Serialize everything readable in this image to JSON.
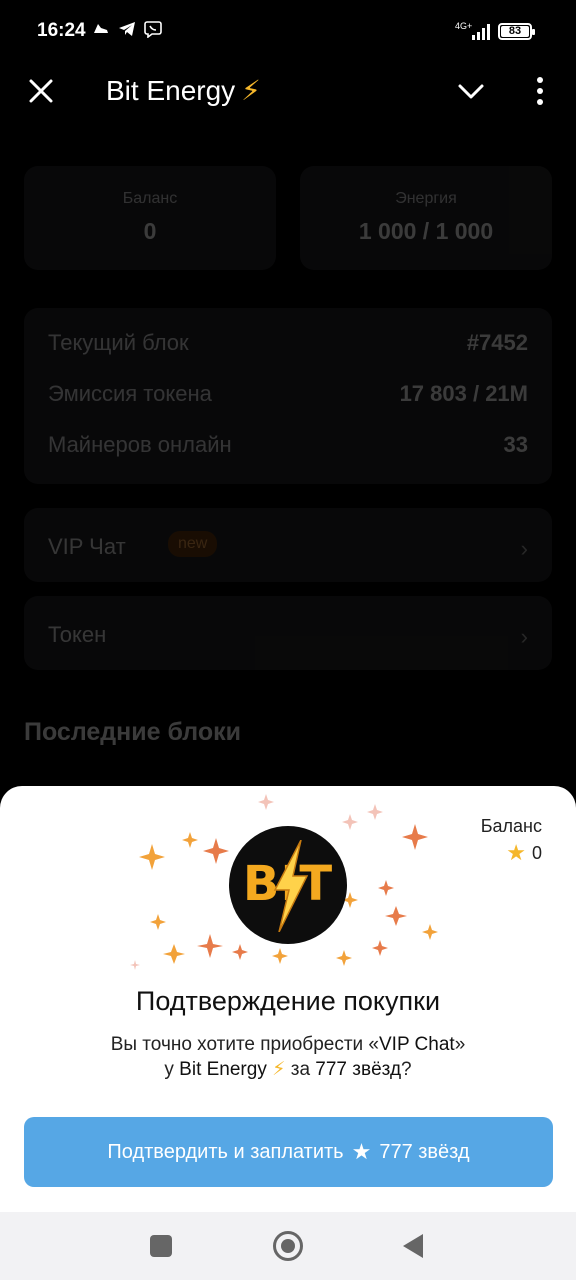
{
  "status_bar": {
    "time": "16:24",
    "network": "4G+",
    "battery": "83",
    "icons": [
      "sneaker-icon",
      "telegram-icon",
      "viber-icon"
    ]
  },
  "header": {
    "title": "Bit Energy",
    "title_emoji": "⚡"
  },
  "stats": {
    "balance_label": "Баланс",
    "balance_value": "0",
    "energy_label": "Энергия",
    "energy_value": "1 000 / 1 000"
  },
  "info": [
    {
      "label": "Текущий блок",
      "value": "#7452"
    },
    {
      "label": "Эмиссия токена",
      "value": "17 803 / 21M"
    },
    {
      "label": "Майнеров онлайн",
      "value": "33"
    }
  ],
  "links": {
    "vip_chat": "VIP Чат",
    "vip_badge": "new",
    "token": "Токен"
  },
  "section_title": "Последние блоки",
  "sheet": {
    "balance_label": "Баланс",
    "balance_value": "0",
    "logo_text": "BIT",
    "title": "Подтверждение покупки",
    "desc_prefix": "Вы точно хотите приобрести «",
    "desc_item": "VIP Chat",
    "desc_mid": "»",
    "desc_line2_prefix": "у ",
    "desc_bot": "Bit Energy",
    "desc_bolt": "⚡",
    "desc_for": " за ",
    "desc_amount": "777 звёзд",
    "desc_q": "?",
    "button_text": "Подтвердить и заплатить",
    "button_amount": "777 звёзд"
  },
  "colors": {
    "accent": "#56a7e5",
    "star": "#f5b72b",
    "background": "#000000"
  }
}
